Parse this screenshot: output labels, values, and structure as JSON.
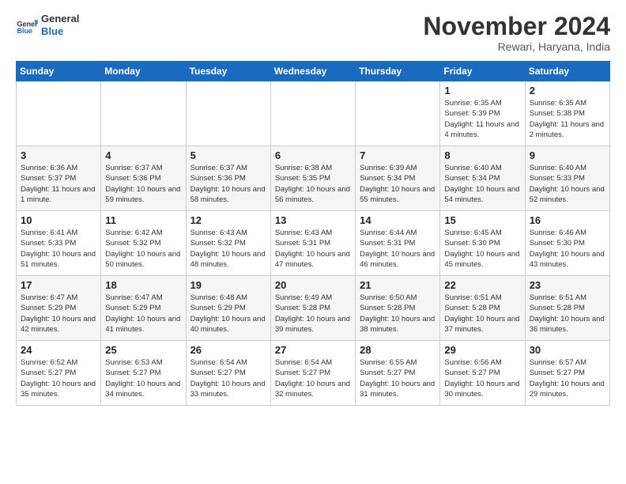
{
  "logo": {
    "general": "General",
    "blue": "Blue"
  },
  "title": "November 2024",
  "location": "Rewari, Haryana, India",
  "days_header": [
    "Sunday",
    "Monday",
    "Tuesday",
    "Wednesday",
    "Thursday",
    "Friday",
    "Saturday"
  ],
  "weeks": [
    [
      {
        "day": "",
        "info": ""
      },
      {
        "day": "",
        "info": ""
      },
      {
        "day": "",
        "info": ""
      },
      {
        "day": "",
        "info": ""
      },
      {
        "day": "",
        "info": ""
      },
      {
        "day": "1",
        "info": "Sunrise: 6:35 AM\nSunset: 5:39 PM\nDaylight: 11 hours and 4 minutes."
      },
      {
        "day": "2",
        "info": "Sunrise: 6:35 AM\nSunset: 5:38 PM\nDaylight: 11 hours and 2 minutes."
      }
    ],
    [
      {
        "day": "3",
        "info": "Sunrise: 6:36 AM\nSunset: 5:37 PM\nDaylight: 11 hours and 1 minute."
      },
      {
        "day": "4",
        "info": "Sunrise: 6:37 AM\nSunset: 5:36 PM\nDaylight: 10 hours and 59 minutes."
      },
      {
        "day": "5",
        "info": "Sunrise: 6:37 AM\nSunset: 5:36 PM\nDaylight: 10 hours and 58 minutes."
      },
      {
        "day": "6",
        "info": "Sunrise: 6:38 AM\nSunset: 5:35 PM\nDaylight: 10 hours and 56 minutes."
      },
      {
        "day": "7",
        "info": "Sunrise: 6:39 AM\nSunset: 5:34 PM\nDaylight: 10 hours and 55 minutes."
      },
      {
        "day": "8",
        "info": "Sunrise: 6:40 AM\nSunset: 5:34 PM\nDaylight: 10 hours and 54 minutes."
      },
      {
        "day": "9",
        "info": "Sunrise: 6:40 AM\nSunset: 5:33 PM\nDaylight: 10 hours and 52 minutes."
      }
    ],
    [
      {
        "day": "10",
        "info": "Sunrise: 6:41 AM\nSunset: 5:33 PM\nDaylight: 10 hours and 51 minutes."
      },
      {
        "day": "11",
        "info": "Sunrise: 6:42 AM\nSunset: 5:32 PM\nDaylight: 10 hours and 50 minutes."
      },
      {
        "day": "12",
        "info": "Sunrise: 6:43 AM\nSunset: 5:32 PM\nDaylight: 10 hours and 48 minutes."
      },
      {
        "day": "13",
        "info": "Sunrise: 6:43 AM\nSunset: 5:31 PM\nDaylight: 10 hours and 47 minutes."
      },
      {
        "day": "14",
        "info": "Sunrise: 6:44 AM\nSunset: 5:31 PM\nDaylight: 10 hours and 46 minutes."
      },
      {
        "day": "15",
        "info": "Sunrise: 6:45 AM\nSunset: 5:30 PM\nDaylight: 10 hours and 45 minutes."
      },
      {
        "day": "16",
        "info": "Sunrise: 6:46 AM\nSunset: 5:30 PM\nDaylight: 10 hours and 43 minutes."
      }
    ],
    [
      {
        "day": "17",
        "info": "Sunrise: 6:47 AM\nSunset: 5:29 PM\nDaylight: 10 hours and 42 minutes."
      },
      {
        "day": "18",
        "info": "Sunrise: 6:47 AM\nSunset: 5:29 PM\nDaylight: 10 hours and 41 minutes."
      },
      {
        "day": "19",
        "info": "Sunrise: 6:48 AM\nSunset: 5:29 PM\nDaylight: 10 hours and 40 minutes."
      },
      {
        "day": "20",
        "info": "Sunrise: 6:49 AM\nSunset: 5:28 PM\nDaylight: 10 hours and 39 minutes."
      },
      {
        "day": "21",
        "info": "Sunrise: 6:50 AM\nSunset: 5:28 PM\nDaylight: 10 hours and 38 minutes."
      },
      {
        "day": "22",
        "info": "Sunrise: 6:51 AM\nSunset: 5:28 PM\nDaylight: 10 hours and 37 minutes."
      },
      {
        "day": "23",
        "info": "Sunrise: 6:51 AM\nSunset: 5:28 PM\nDaylight: 10 hours and 36 minutes."
      }
    ],
    [
      {
        "day": "24",
        "info": "Sunrise: 6:52 AM\nSunset: 5:27 PM\nDaylight: 10 hours and 35 minutes."
      },
      {
        "day": "25",
        "info": "Sunrise: 6:53 AM\nSunset: 5:27 PM\nDaylight: 10 hours and 34 minutes."
      },
      {
        "day": "26",
        "info": "Sunrise: 6:54 AM\nSunset: 5:27 PM\nDaylight: 10 hours and 33 minutes."
      },
      {
        "day": "27",
        "info": "Sunrise: 6:54 AM\nSunset: 5:27 PM\nDaylight: 10 hours and 32 minutes."
      },
      {
        "day": "28",
        "info": "Sunrise: 6:55 AM\nSunset: 5:27 PM\nDaylight: 10 hours and 31 minutes."
      },
      {
        "day": "29",
        "info": "Sunrise: 6:56 AM\nSunset: 5:27 PM\nDaylight: 10 hours and 30 minutes."
      },
      {
        "day": "30",
        "info": "Sunrise: 6:57 AM\nSunset: 5:27 PM\nDaylight: 10 hours and 29 minutes."
      }
    ]
  ]
}
